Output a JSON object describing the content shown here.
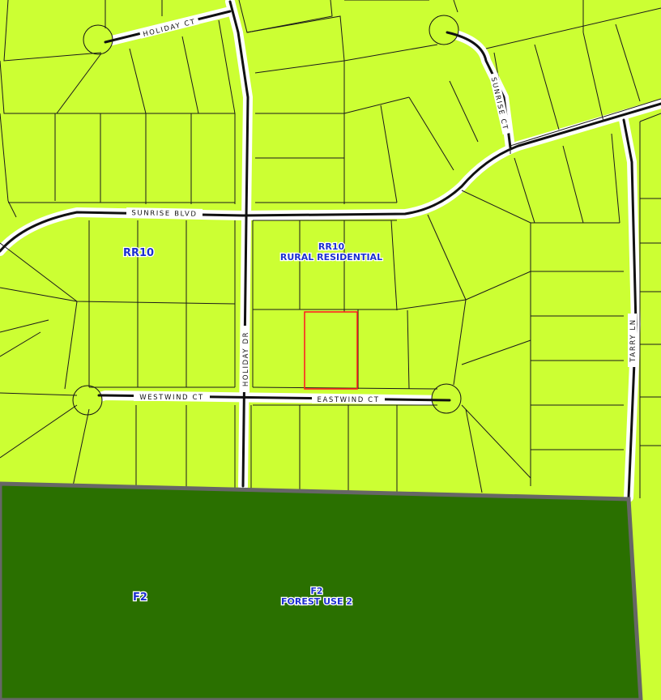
{
  "streets": {
    "holiday_ct": "HOLIDAY CT",
    "sunrise_ct": "SUNRISE CT",
    "sunrise_blvd": "SUNRISE BLVD",
    "holiday_dr": "HOLIDAY DR",
    "westwind_ct": "WESTWIND CT",
    "eastwind_ct": "EASTWIND CT",
    "tarry_ln": "TARRY LN"
  },
  "zones": {
    "rr10_left": {
      "code": "RR10"
    },
    "rr10_center": {
      "code": "RR10",
      "name": "RURAL RESIDENTIAL"
    },
    "f2_left": {
      "code": "F2"
    },
    "f2_center": {
      "code": "F2",
      "name": "FOREST USE 2"
    }
  },
  "colors": {
    "residential_zone": "#CCFF33",
    "forest_zone": "#2A7000",
    "road_casing": "#111111",
    "parcel_line": "#1a1a1a",
    "zone_boundary": "#666666",
    "highlight_parcel": "#FF2020",
    "label_text": "#1C2FD0"
  },
  "highlighted_parcel": {
    "description": "subject parcel outlined in red"
  }
}
